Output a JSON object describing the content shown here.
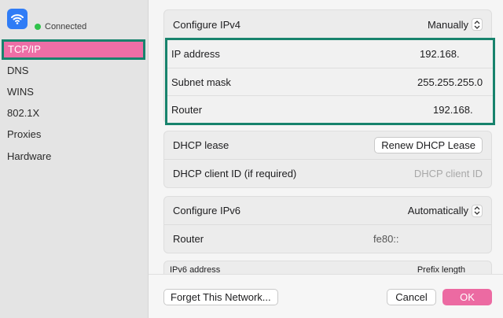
{
  "sidebar": {
    "status": "Connected",
    "items": [
      {
        "label": "TCP/IP"
      },
      {
        "label": "DNS"
      },
      {
        "label": "WINS"
      },
      {
        "label": "802.1X"
      },
      {
        "label": "Proxies"
      },
      {
        "label": "Hardware"
      }
    ]
  },
  "ipv4": {
    "configure_label": "Configure IPv4",
    "configure_value": "Manually",
    "ip_label": "IP address",
    "ip_value": "192.168.",
    "subnet_label": "Subnet mask",
    "subnet_value": "255.255.255.0",
    "router_label": "Router",
    "router_value": "192.168."
  },
  "dhcp": {
    "lease_label": "DHCP lease",
    "renew_button": "Renew DHCP Lease",
    "client_id_label": "DHCP client ID (if required)",
    "client_id_placeholder": "DHCP client ID"
  },
  "ipv6": {
    "configure_label": "Configure IPv6",
    "configure_value": "Automatically",
    "router_label": "Router",
    "router_value": "fe80::",
    "address_header": "IPv6 address",
    "prefix_header": "Prefix length"
  },
  "footer": {
    "forget_button": "Forget This Network...",
    "cancel_button": "Cancel",
    "ok_button": "OK"
  },
  "colors": {
    "accent_pink": "#ee6ea6",
    "highlight_green": "#18836d",
    "status_green": "#30c24b",
    "wifi_blue": "#2f7cf6"
  }
}
